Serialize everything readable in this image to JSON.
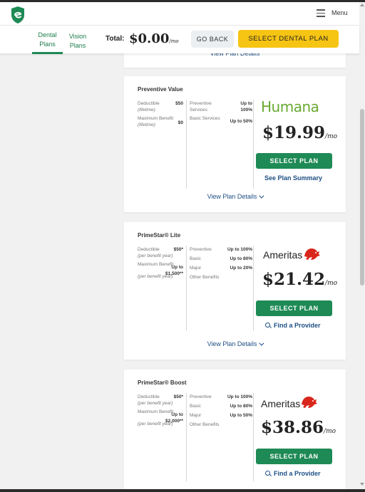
{
  "header": {
    "menu_label": "Menu"
  },
  "subnav": {
    "tabs": [
      {
        "line1": "Dental",
        "line2": "Plans",
        "active": true
      },
      {
        "line1": "Vision",
        "line2": "Plans",
        "active": false
      }
    ],
    "total_label": "Total:",
    "total_value": "$0.00",
    "total_suffix": "/mo",
    "back_label": "GO BACK",
    "select_label": "SELECT DENTAL PLAN"
  },
  "colors": {
    "accent_green": "#1e8a55",
    "cta_yellow": "#f6c413",
    "link_blue": "#1d4f84",
    "humana_green": "#6aaa33",
    "ameritas_red": "#d9261c"
  },
  "top_card": {
    "view_details": "View Plan Details"
  },
  "plans": [
    {
      "name": "Preventive Value",
      "brand": "Humana",
      "details": [
        {
          "label": "Deductible",
          "sub": "(lifetime)",
          "value": "$50"
        },
        {
          "label": "Maximum Benefit",
          "sub": "(lifetime)",
          "value": "$0"
        }
      ],
      "coverage": [
        {
          "label": "Preventive Services",
          "value": "Up to 100%"
        },
        {
          "label": "Basic Services",
          "value": "Up to 50%"
        }
      ],
      "price": "$19.99",
      "price_suffix": "/mo",
      "select_label": "SELECT PLAN",
      "secondary_link": "See Plan Summary",
      "view_details": "View Plan Details"
    },
    {
      "name": "PrimeStar® Lite",
      "brand": "Ameritas",
      "details": [
        {
          "label": "Deductible",
          "sub": "(per benefit year)",
          "value": "$50*"
        },
        {
          "label": "Maximum Benefit",
          "value_line1": "Up to",
          "value": "$1,500**",
          "sub": "(per benefit year)"
        }
      ],
      "coverage": [
        {
          "label": "Preventive",
          "value": "Up to 100%"
        },
        {
          "label": "Basic",
          "value": "Up to 80%"
        },
        {
          "label": "Major",
          "value": "Up to 20%"
        },
        {
          "label": "Other Benefits",
          "value": ""
        }
      ],
      "price": "$21.42",
      "price_suffix": "/mo",
      "select_label": "SELECT PLAN",
      "secondary_link": "Find a Provider",
      "view_details": "View Plan Details"
    },
    {
      "name": "PrimeStar® Boost",
      "brand": "Ameritas",
      "details": [
        {
          "label": "Deductible",
          "sub": "(per benefit year)",
          "value": "$50*"
        },
        {
          "label": "Maximum Benefit",
          "value_line1": "Up to",
          "value": "$2,000**",
          "sub": "(per benefit year)"
        }
      ],
      "coverage": [
        {
          "label": "Preventive",
          "value": "Up to 100%"
        },
        {
          "label": "Basic",
          "value": "Up to 80%"
        },
        {
          "label": "Major",
          "value": "Up to 50%"
        },
        {
          "label": "Other Benefits",
          "value": ""
        }
      ],
      "price": "$38.86",
      "price_suffix": "/mo",
      "select_label": "SELECT PLAN",
      "secondary_link": "Find a Provider"
    }
  ]
}
